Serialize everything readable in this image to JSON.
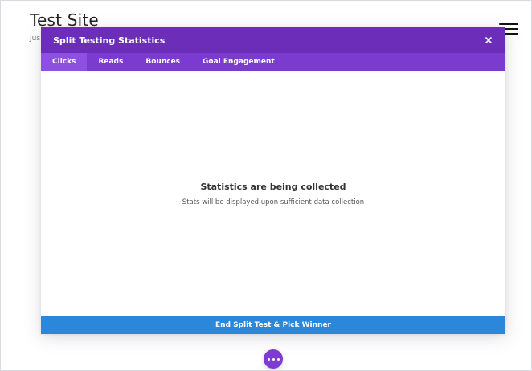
{
  "site": {
    "title": "Test Site",
    "tagline": "Jus"
  },
  "modal": {
    "title": "Split Testing Statistics",
    "close_icon": "close-icon",
    "tabs": [
      {
        "label": "Clicks",
        "active": true
      },
      {
        "label": "Reads",
        "active": false
      },
      {
        "label": "Bounces",
        "active": false
      },
      {
        "label": "Goal Engagement",
        "active": false
      }
    ],
    "empty_state": {
      "title": "Statistics are being collected",
      "subtitle": "Stats will be displayed upon sufficient data collection"
    },
    "footer_button_label": "End Split Test & Pick Winner"
  },
  "floating_button": {
    "icon": "ellipsis-icon"
  },
  "colors": {
    "header": "#6c2eb9",
    "tab_bar": "#7b3bd1",
    "tab_active": "#8e4fe3",
    "footer_button": "#2b87da",
    "fab": "#7e3bd0"
  }
}
